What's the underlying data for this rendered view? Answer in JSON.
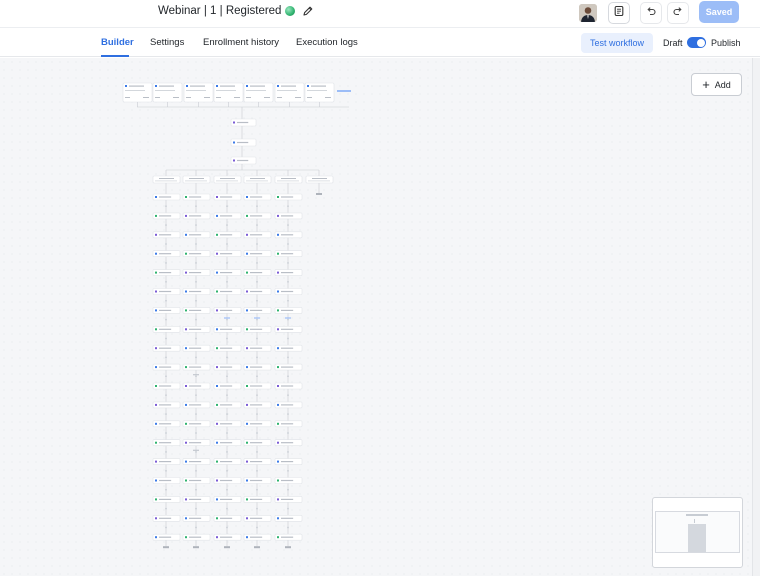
{
  "header": {
    "title_name": "Webinar",
    "title_sep1": "|",
    "title_version": "1",
    "title_sep2": "|",
    "title_status": "Registered",
    "saved_label": "Saved"
  },
  "tabs": [
    {
      "label": "Builder",
      "active": true
    },
    {
      "label": "Settings",
      "active": false
    },
    {
      "label": "Enrollment history",
      "active": false
    },
    {
      "label": "Execution logs",
      "active": false
    }
  ],
  "actions": {
    "test_label": "Test workflow",
    "draft_label": "Draft",
    "publish_label": "Publish",
    "publish_enabled": true
  },
  "canvas": {
    "add_label": "Add"
  },
  "colors": {
    "accent": "#2f6fe0",
    "saved_bg": "#9cbdf7",
    "node_blue": "#3c7be8",
    "node_green": "#2fb36f",
    "node_purple": "#7b5cd6"
  },
  "icons": {
    "status": "green-dot-icon",
    "edit": "pencil-icon",
    "notes": "document-icon",
    "undo": "undo-icon",
    "redo": "redo-icon",
    "add": "plus-icon"
  }
}
